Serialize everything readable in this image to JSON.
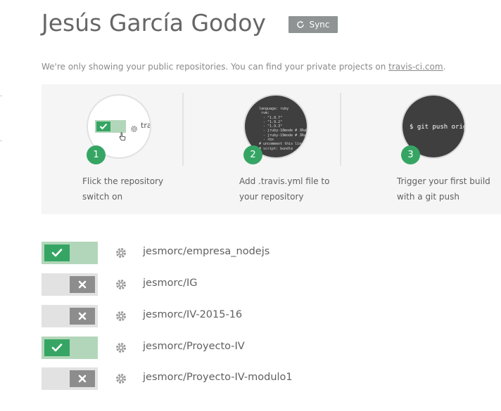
{
  "header": {
    "user_name": "Jesús García Godoy",
    "sync_label": "Sync"
  },
  "notice": {
    "text": "We're only showing your public repositories. You can find your private projects on ",
    "link": "travis-ci.com",
    "suffix": "."
  },
  "steps": [
    {
      "number": "1",
      "line1": "Flick the repository",
      "line2": "switch on",
      "preview_text": "tra"
    },
    {
      "number": "2",
      "line1": "Add .travis.yml file to",
      "line2": "your repository",
      "preview_text": "language: ruby\n rvm:\n  - \"1.8.7\"\n  - \"1.9.2\"\n  - \"1.9.3\"\n  - jruby-18mode # JRuby\n  - jruby-19mode # JRuby\n  - rbx\n# uncomment this line\n# script: bundle"
    },
    {
      "number": "3",
      "line1": "Trigger your first build",
      "line2": "with a git push",
      "preview_text": "$ git push origin"
    }
  ],
  "repos": [
    {
      "name": "jesmorc/empresa_nodejs",
      "enabled": true
    },
    {
      "name": "jesmorc/IG",
      "enabled": false
    },
    {
      "name": "jesmorc/IV-2015-16",
      "enabled": false
    },
    {
      "name": "jesmorc/Proyecto-IV",
      "enabled": true
    },
    {
      "name": "jesmorc/Proyecto-IV-modulo1",
      "enabled": false
    }
  ],
  "colors": {
    "accent_green": "#36a564",
    "toggle_on_track": "#b2d6b9",
    "toggle_off_track": "#e2e2e2",
    "toggle_off_knob": "#8d8d8d",
    "sync_button": "#8e9393",
    "panel_bg": "#f5f5f5"
  },
  "icons": {
    "sync": "refresh-icon",
    "settings": "gear-icon",
    "enabled": "check-icon",
    "disabled": "x-icon"
  }
}
